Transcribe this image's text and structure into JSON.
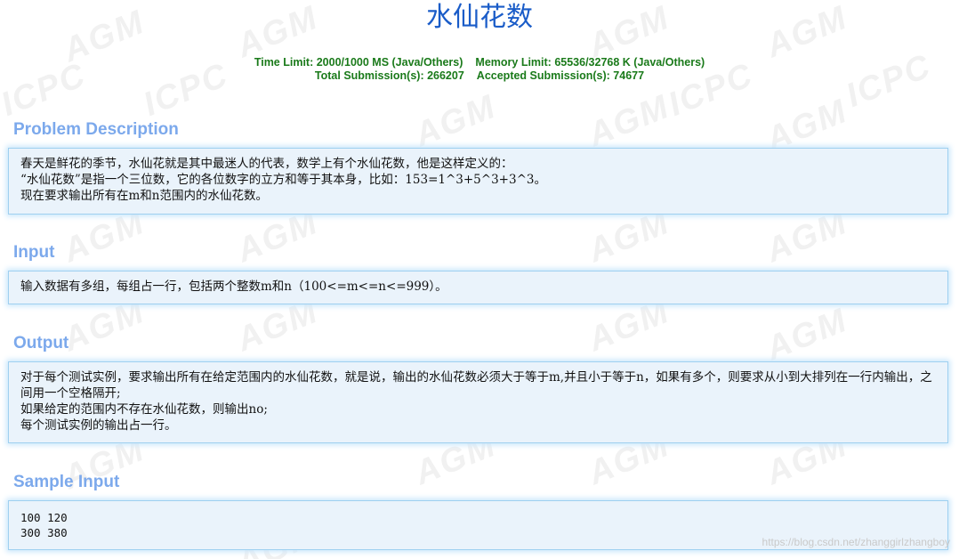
{
  "problem": {
    "title": "水仙花数",
    "limits": {
      "time_limit": "Time Limit: 2000/1000 MS (Java/Others)",
      "memory_limit": "Memory Limit: 65536/32768 K (Java/Others)",
      "total_submissions": "Total Submission(s): 266207",
      "accepted_submissions": "Accepted Submission(s): 74677"
    }
  },
  "sections": {
    "description": {
      "heading": "Problem Description",
      "lines": [
        "春天是鲜花的季节，水仙花就是其中最迷人的代表，数学上有个水仙花数，他是这样定义的：",
        "“水仙花数”是指一个三位数，它的各位数字的立方和等于其本身，比如：153=1^3+5^3+3^3。",
        "现在要求输出所有在m和n范围内的水仙花数。"
      ]
    },
    "input": {
      "heading": "Input",
      "lines": [
        "输入数据有多组，每组占一行，包括两个整数m和n（100<=m<=n<=999）。"
      ]
    },
    "output": {
      "heading": "Output",
      "lines": [
        "对于每个测试实例，要求输出所有在给定范围内的水仙花数，就是说，输出的水仙花数必须大于等于m,并且小于等于n，如果有多个，则要求从小到大排列在一行内输出，之间用一个空格隔开;",
        "如果给定的范围内不存在水仙花数，则输出no;",
        "每个测试实例的输出占一行。"
      ]
    },
    "sample_input": {
      "heading": "Sample Input",
      "lines": [
        "100 120",
        "300 380"
      ]
    }
  },
  "watermark": {
    "texts": [
      "AGM",
      "ICPC"
    ],
    "url": "https://blog.csdn.net/zhanggirlzhangboy"
  }
}
